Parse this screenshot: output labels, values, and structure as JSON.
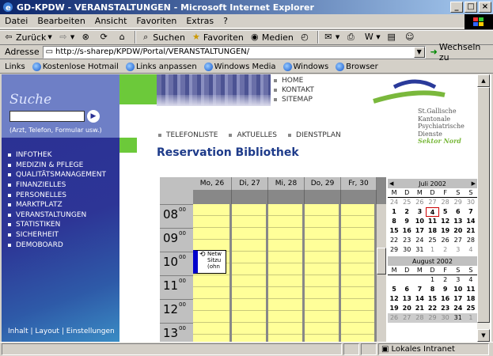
{
  "window": {
    "title": "GD-KPDW - VERANSTALTUNGEN - Microsoft Internet Explorer",
    "controls": [
      "_",
      "□",
      "×"
    ]
  },
  "menubar": {
    "items": [
      "Datei",
      "Bearbeiten",
      "Ansicht",
      "Favoriten",
      "Extras",
      "?"
    ]
  },
  "toolbar": {
    "back": "Zurück",
    "search": "Suchen",
    "favorites": "Favoriten",
    "media": "Medien"
  },
  "addressbar": {
    "label": "Adresse",
    "url": "http://s-sharep/KPDW/Portal/VERANSTALTUNGEN/",
    "go_label": "Wechseln zu"
  },
  "linksbar": {
    "label": "Links",
    "items": [
      "Kostenlose Hotmail",
      "Links anpassen",
      "Windows Media",
      "Windows",
      "Browser"
    ]
  },
  "leftnav": {
    "search_title": "Suche",
    "search_value": "",
    "search_hint": "(Arzt, Telefon, Formular usw.)",
    "items": [
      "INFOTHEK",
      "MEDIZIN & PFLEGE",
      "QUALITÄTSMANAGEMENT",
      "FINANZIELLES",
      "PERSONELLES",
      "MARKTPLATZ",
      "VERANSTALTUNGEN",
      "STATISTIKEN",
      "SICHERHEIT",
      "DEMOBOARD"
    ],
    "footer": "Inhalt | Layout | Einstellungen"
  },
  "topnav": {
    "items": [
      "HOME",
      "KONTAKT",
      "SITEMAP"
    ]
  },
  "logo": {
    "lines": [
      "St.Gallische",
      "Kantonale",
      "Psychiatrische",
      "Dienste"
    ],
    "region": "Sektor Nord"
  },
  "subnav": {
    "items": [
      "TELEFONLISTE",
      "AKTUELLES",
      "DIENSTPLAN"
    ]
  },
  "page": {
    "title": "Reservation Bibliothek"
  },
  "calendar": {
    "days": [
      "Mo, 26",
      "Di, 27",
      "Mi, 28",
      "Do, 29",
      "Fr, 30"
    ],
    "hours": [
      "08",
      "09",
      "10",
      "11",
      "12",
      "13"
    ],
    "minutes": "00",
    "appointment": {
      "line1": "Netw",
      "line2": "Sitzu",
      "line3": "(ohn"
    }
  },
  "minical_july": {
    "title": "Juli 2002",
    "dow": [
      "M",
      "D",
      "M",
      "D",
      "F",
      "S",
      "S"
    ],
    "rows": [
      [
        "24",
        "25",
        "26",
        "27",
        "28",
        "29",
        "30"
      ],
      [
        "1",
        "2",
        "3",
        "4",
        "5",
        "6",
        "7"
      ],
      [
        "8",
        "9",
        "10",
        "11",
        "12",
        "13",
        "14"
      ],
      [
        "15",
        "16",
        "17",
        "18",
        "19",
        "20",
        "21"
      ],
      [
        "22",
        "23",
        "24",
        "25",
        "26",
        "27",
        "28"
      ],
      [
        "29",
        "30",
        "31",
        "1",
        "2",
        "3",
        "4"
      ]
    ],
    "today": "4"
  },
  "minical_august": {
    "title": "August 2002",
    "dow": [
      "M",
      "D",
      "M",
      "D",
      "F",
      "S",
      "S"
    ],
    "rows": [
      [
        "",
        "",
        "",
        "1",
        "2",
        "3",
        "4"
      ],
      [
        "5",
        "6",
        "7",
        "8",
        "9",
        "10",
        "11"
      ],
      [
        "12",
        "13",
        "14",
        "15",
        "16",
        "17",
        "18"
      ],
      [
        "19",
        "20",
        "21",
        "22",
        "23",
        "24",
        "25"
      ],
      [
        "26",
        "27",
        "28",
        "29",
        "30",
        "31",
        "1"
      ]
    ]
  },
  "status": {
    "zone": "Lokales Intranet"
  }
}
